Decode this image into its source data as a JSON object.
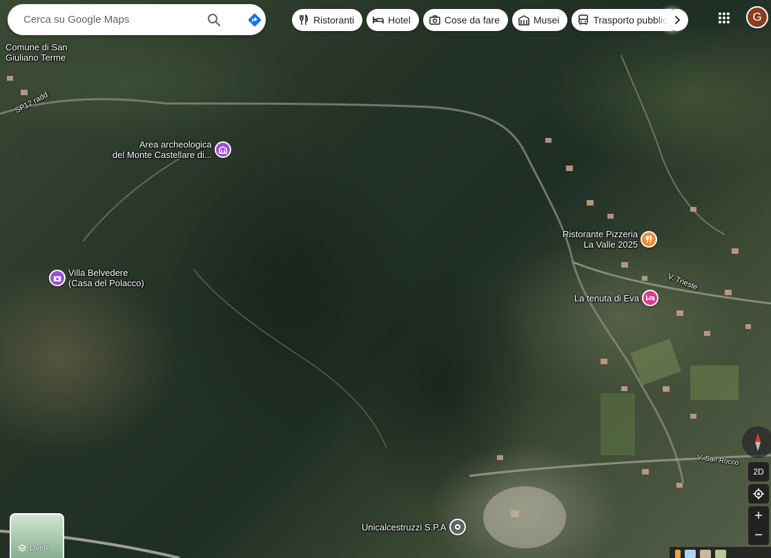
{
  "search": {
    "placeholder": "Cerca su Google Maps"
  },
  "chips": [
    {
      "label": "Ristoranti",
      "icon": "fork-knife-icon"
    },
    {
      "label": "Hotel",
      "icon": "bed-icon"
    },
    {
      "label": "Cose da fare",
      "icon": "camera-icon"
    },
    {
      "label": "Musei",
      "icon": "museum-icon"
    },
    {
      "label": "Trasporto pubblico",
      "icon": "bus-icon"
    }
  ],
  "account": {
    "initial": "G"
  },
  "places": {
    "comune": {
      "line1": "Comune di San",
      "line2": "Giuliano Terme"
    },
    "area": {
      "line1": "Area archeologica",
      "line2": "del Monte Castellare di..."
    },
    "villa": {
      "line1": "Villa Belvedere",
      "line2": "(Casa del Polacco)"
    },
    "ristorante": {
      "line1": "Ristorante Pizzeria",
      "line2": "La Valle 2025"
    },
    "tenuta": {
      "line1": "La tenuta di Eva"
    },
    "unical": {
      "line1": "Unicalcestruzzi S.P.A"
    }
  },
  "roads": {
    "sp12": "SP12 radd",
    "trieste": "V. Trieste",
    "sanrocco": "V. San Rocco"
  },
  "controls": {
    "view_mode": "2D",
    "zoom_in": "+",
    "zoom_out": "−"
  },
  "layers": {
    "label": "Livelli"
  },
  "colors": {
    "museum_pin": "#9c4fd6",
    "restaurant_pin": "#f28b2c",
    "hotel_pin": "#d83f8c",
    "directions": "#1a73e8"
  }
}
